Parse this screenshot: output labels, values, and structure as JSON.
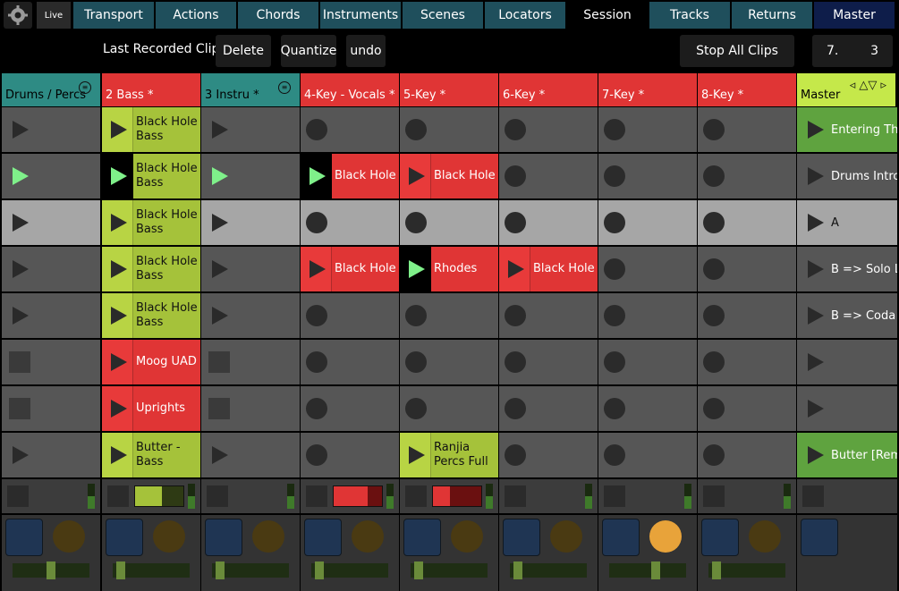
{
  "tabs": {
    "live": "Live",
    "items": [
      "Transport",
      "Actions",
      "Chords",
      "Instruments",
      "Scenes",
      "Locators",
      "Session",
      "Tracks",
      "Returns",
      "Master"
    ],
    "active": "Session"
  },
  "toolbar": {
    "label": "Last Recorded Clip:",
    "delete": "Delete",
    "quantize": "Quantize",
    "undo": "undo",
    "stop_all": "Stop All Clips",
    "pos_a": "7.",
    "pos_b": "3"
  },
  "tracks": [
    {
      "name": "Drums / Percs",
      "color": "teal",
      "menu": true
    },
    {
      "name": "2 Bass *",
      "color": "red",
      "menu": false
    },
    {
      "name": "3 Instru *",
      "color": "teal",
      "menu": true
    },
    {
      "name": "4-Key - Vocals *",
      "color": "red",
      "menu": false
    },
    {
      "name": "5-Key *",
      "color": "red",
      "menu": false
    },
    {
      "name": "6-Key *",
      "color": "red",
      "menu": false
    },
    {
      "name": "7-Key *",
      "color": "red",
      "menu": false
    },
    {
      "name": "8-Key *",
      "color": "red",
      "menu": false
    }
  ],
  "master": {
    "name": "Master",
    "arrows": "◃ △▽ ▹"
  },
  "clips": [
    [
      "play",
      "lime:Black Hole Bass",
      "play",
      "dot",
      "dot",
      "dot",
      "dot",
      "dot"
    ],
    [
      "playgreen",
      "lime-playing:Black Hole Bass",
      "playgreen",
      "red-playing:Black Hole",
      "red:Black Hole",
      "dot",
      "dot",
      "dot"
    ],
    [
      "play",
      "lime:Black Hole Bass",
      "play",
      "dot",
      "dot",
      "dot",
      "dot",
      "dot"
    ],
    [
      "play",
      "lime:Black Hole Bass",
      "play",
      "red:Black Hole",
      "red-playing:Rhodes",
      "red:Black Hole",
      "dot",
      "dot"
    ],
    [
      "play",
      "lime:Black Hole Bass",
      "play",
      "dot",
      "dot",
      "dot",
      "dot",
      "dot"
    ],
    [
      "stop",
      "red:Moog UAD",
      "stop",
      "dot",
      "dot",
      "dot",
      "dot",
      "dot"
    ],
    [
      "stop",
      "red:Uprights",
      "stop",
      "dot",
      "dot",
      "dot",
      "dot",
      "dot"
    ],
    [
      "play",
      "lime:Butter - Bass",
      "play",
      "dot",
      "lime:Ranjia Percs Full",
      "dot",
      "dot",
      "dot"
    ]
  ],
  "scenes": [
    {
      "name": "Entering Th",
      "style": "green"
    },
    {
      "name": "Drums Intro",
      "style": "dark"
    },
    {
      "name": "A",
      "style": "light"
    },
    {
      "name": "B => Solo Lo",
      "style": "dark"
    },
    {
      "name": "B => Coda",
      "style": "dark"
    },
    {
      "name": "",
      "style": "dark"
    },
    {
      "name": "",
      "style": "dark"
    },
    {
      "name": "Butter [Rem",
      "style": "green"
    }
  ],
  "meters": [
    0,
    0.55,
    0,
    0.7,
    0.35,
    0,
    0,
    0
  ],
  "knobs": [
    false,
    false,
    false,
    false,
    false,
    false,
    true,
    false
  ],
  "faders": [
    0.5,
    0.05,
    0.05,
    0.05,
    0.05,
    0.05,
    0.62,
    0.05
  ],
  "colors": {
    "teal": "#2e8b84",
    "red": "#e03535",
    "lime": "#a5c23a",
    "masterhdr": "#c5e84a",
    "green": "#5fa33f"
  }
}
